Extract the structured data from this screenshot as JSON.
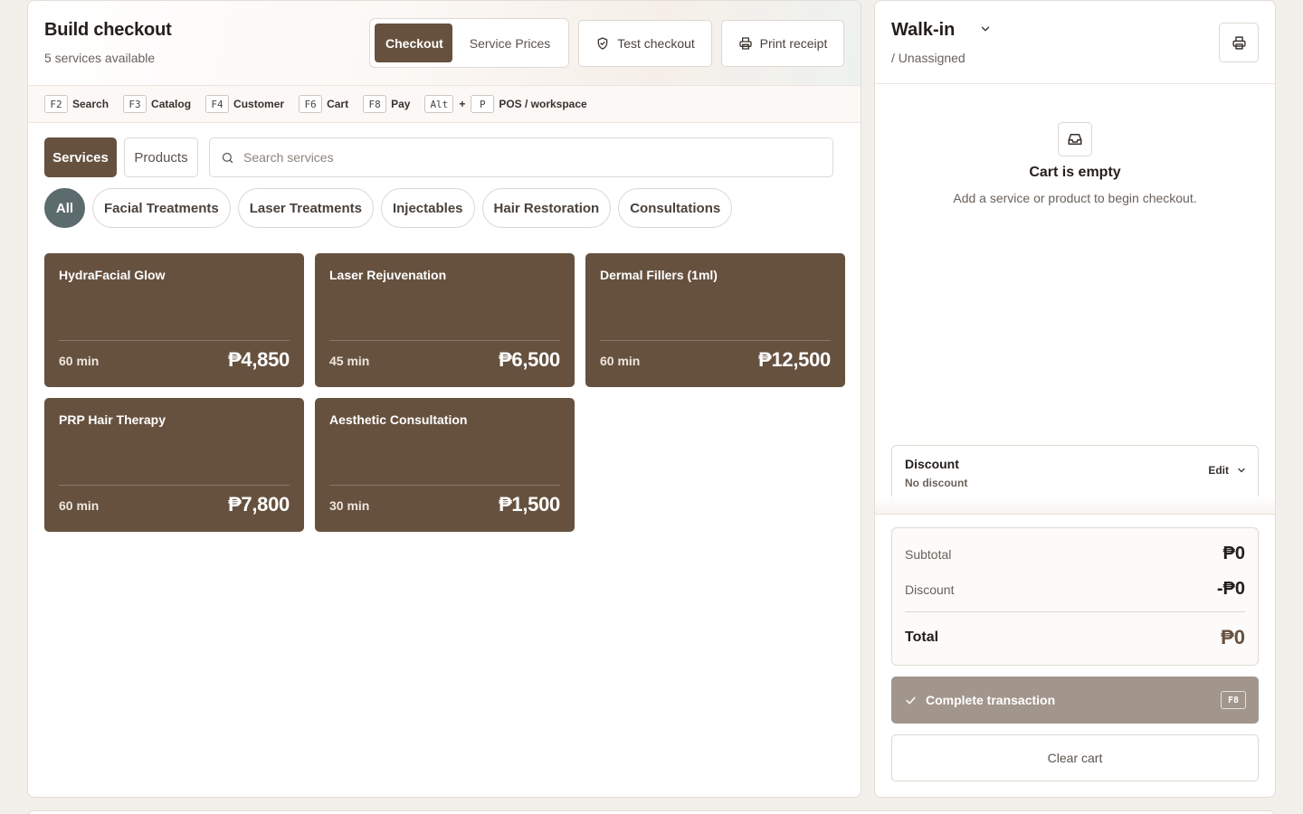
{
  "checkout": {
    "title": "Build checkout",
    "subtitle": "5 services available",
    "tabs": [
      {
        "label": "Checkout",
        "active": true
      },
      {
        "label": "Service Prices",
        "active": false
      }
    ],
    "test_checkout_label": "Test checkout",
    "print_receipt_label": "Print receipt"
  },
  "shortcuts": [
    {
      "key": "F2",
      "label": "Search"
    },
    {
      "key": "F3",
      "label": "Catalog"
    },
    {
      "key": "F4",
      "label": "Customer"
    },
    {
      "key": "F6",
      "label": "Cart"
    },
    {
      "key": "F8",
      "label": "Pay"
    }
  ],
  "combo_shortcut": {
    "key1": "Alt",
    "plus": "+",
    "key2": "P",
    "label": "POS / workspace"
  },
  "catalog": {
    "type_services": "Services",
    "type_products": "Products",
    "search_placeholder": "Search services",
    "categories": [
      "All",
      "Facial Treatments",
      "Laser Treatments",
      "Injectables",
      "Hair Restoration",
      "Consultations"
    ]
  },
  "services": [
    {
      "name": "HydraFacial Glow",
      "duration": "60 min",
      "price": "₱4,850"
    },
    {
      "name": "Laser Rejuvenation",
      "duration": "45 min",
      "price": "₱6,500"
    },
    {
      "name": "Dermal Fillers (1ml)",
      "duration": "60 min",
      "price": "₱12,500"
    },
    {
      "name": "PRP Hair Therapy",
      "duration": "60 min",
      "price": "₱7,800"
    },
    {
      "name": "Aesthetic Consultation",
      "duration": "30 min",
      "price": "₱1,500"
    }
  ],
  "customer": {
    "name": "Walk-in",
    "assignment": "/ Unassigned"
  },
  "cart": {
    "empty_title": "Cart is empty",
    "empty_subtitle": "Add a service or product to begin checkout."
  },
  "discount": {
    "title": "Discount",
    "value": "No discount",
    "edit_label": "Edit"
  },
  "totals": {
    "subtotal_label": "Subtotal",
    "subtotal_value": "₱0",
    "discount_label": "Discount",
    "discount_value": "-₱0",
    "total_label": "Total",
    "total_value": "₱0"
  },
  "actions": {
    "complete_label": "Complete transaction",
    "complete_key": "F8",
    "clear_label": "Clear cart"
  },
  "colors": {
    "brand_brown": "#66513f",
    "chip_active": "#5c6b6e",
    "complete_disabled": "#a2968c",
    "page_background": "#f3efea"
  }
}
